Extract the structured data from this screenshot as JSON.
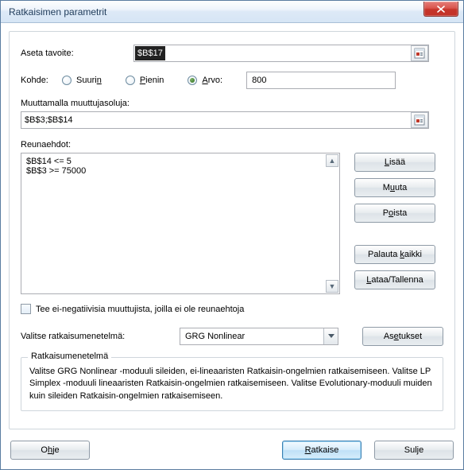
{
  "window": {
    "title": "Ratkaisimen parametrit"
  },
  "form": {
    "set_goal_label": "Aseta tavoite:",
    "set_goal_value": "$B$17",
    "target_label": "Kohde:",
    "radios": {
      "max_pre": "Suuri",
      "max_ul": "n",
      "min_pre": "",
      "min_ul": "P",
      "min_post": "ienin",
      "val_pre": "",
      "val_ul": "A",
      "val_post": "rvo:"
    },
    "target_value": "800",
    "change_label": "Muuttamalla muuttujasoluja:",
    "change_value": "$B$3;$B$14",
    "constraints_label": "Reunaehdot:",
    "constraints": [
      "$B$14 <= 5",
      "$B$3 >= 75000"
    ],
    "buttons": {
      "add_pre": "",
      "add_ul": "L",
      "add_post": "isää",
      "change_pre": "M",
      "change_ul": "u",
      "change_post": "uta",
      "delete_pre": "P",
      "delete_ul": "o",
      "delete_post": "ista",
      "reset_pre": "Palauta ",
      "reset_ul": "k",
      "reset_post": "aikki",
      "loadsave_pre": "",
      "loadsave_ul": "L",
      "loadsave_post": "ataa/Tallenna",
      "options_pre": "As",
      "options_ul": "e",
      "options_post": "tukset"
    },
    "nonneg_pre": "Tee ei-negatiivisia muuttujista, joilla ei ole reunaehtoja",
    "method_label": "Valitse ratkaisumenetelmä:",
    "method_value": "GRG Nonlinear",
    "group_legend": "Ratkaisumenetelmä",
    "group_desc": "Valitse GRG Nonlinear -moduuli sileiden, ei-lineaaristen Ratkaisin-ongelmien ratkaisemiseen. Valitse LP Simplex -moduuli lineaaristen Ratkaisin-ongelmien ratkaisemiseen. Valitse Evolutionary-moduuli muiden kuin sileiden Ratkaisin-ongelmien ratkaisemiseen."
  },
  "footer": {
    "help_pre": "O",
    "help_ul": "h",
    "help_post": "je",
    "solve_pre": "",
    "solve_ul": "R",
    "solve_post": "atkaise",
    "close_pre": "Sul",
    "close_ul": "j",
    "close_post": "e"
  }
}
